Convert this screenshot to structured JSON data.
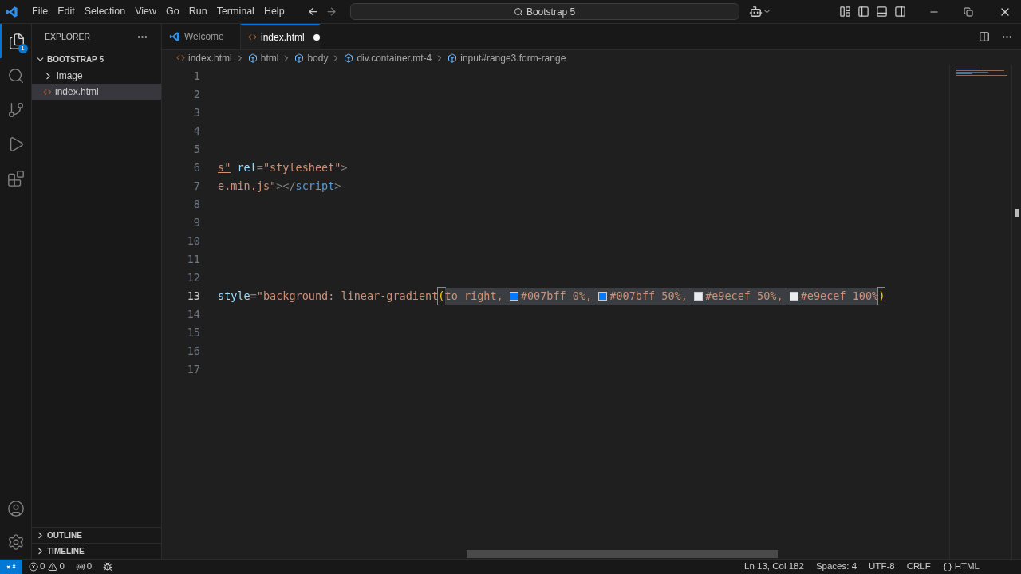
{
  "menu": [
    "File",
    "Edit",
    "Selection",
    "View",
    "Go",
    "Run",
    "Terminal",
    "Help"
  ],
  "command_center": {
    "value": "Bootstrap 5"
  },
  "activity_bar": {
    "explorer_badge": "1",
    "items": [
      {
        "kind": "files",
        "selected": true
      },
      {
        "kind": "search",
        "selected": false
      },
      {
        "kind": "source-control",
        "selected": false
      },
      {
        "kind": "run",
        "selected": false
      },
      {
        "kind": "extensions",
        "selected": false
      }
    ]
  },
  "sidebar": {
    "title": "EXPLORER",
    "folder": {
      "name": "BOOTSTRAP 5",
      "expanded": true,
      "children": [
        {
          "name": "image",
          "kind": "folder",
          "selected": false
        },
        {
          "name": "index.html",
          "kind": "html",
          "selected": true
        }
      ]
    },
    "panels": [
      {
        "name": "OUTLINE",
        "expanded": false
      },
      {
        "name": "TIMELINE",
        "expanded": false
      }
    ]
  },
  "tabs": [
    {
      "label": "Welcome",
      "kind": "welcome",
      "selected": false,
      "modified": false
    },
    {
      "label": "index.html",
      "kind": "html",
      "selected": true,
      "modified": true
    }
  ],
  "breadcrumbs": [
    {
      "label": "index.html",
      "kind": "file"
    },
    {
      "label": "html",
      "kind": "element"
    },
    {
      "label": "body",
      "kind": "element"
    },
    {
      "label": "div.container.mt-4",
      "kind": "element"
    },
    {
      "label": "input#range3.form-range",
      "kind": "element"
    }
  ],
  "editor": {
    "lines": [
      {
        "number": "1",
        "current": false
      },
      {
        "number": "2",
        "current": false
      },
      {
        "number": "3",
        "current": false
      },
      {
        "number": "4",
        "current": false
      },
      {
        "number": "5",
        "current": false
      },
      {
        "number": "6",
        "current": false,
        "tokens": [
          {
            "text": "s\"",
            "kind": "link"
          },
          {
            "text": " rel",
            "kind": "attr"
          },
          {
            "text": "=",
            "kind": "punct"
          },
          {
            "text": "\"stylesheet\"",
            "kind": "string"
          },
          {
            "text": ">",
            "kind": "punct"
          }
        ]
      },
      {
        "number": "7",
        "current": false,
        "tokens": [
          {
            "text": "e.min.js\"",
            "kind": "link"
          },
          {
            "text": "></",
            "kind": "punct"
          },
          {
            "text": "script",
            "kind": "tag"
          },
          {
            "text": ">",
            "kind": "punct"
          }
        ]
      },
      {
        "number": "8",
        "current": false
      },
      {
        "number": "9",
        "current": false
      },
      {
        "number": "10",
        "current": false
      },
      {
        "number": "11",
        "current": false
      },
      {
        "number": "12",
        "current": false
      },
      {
        "number": "13",
        "current": true,
        "tokens": [
          {
            "text": "style",
            "kind": "attr"
          },
          {
            "text": "=",
            "kind": "punct"
          },
          {
            "text": "\"background: linear-gradient",
            "kind": "string"
          },
          {
            "text": "(",
            "kind": "bracket"
          },
          {
            "text": "to right, ",
            "kind": "string",
            "highlighted": true
          },
          {
            "text": "#007bff 0%, ",
            "kind": "swatch",
            "color": "#007bff",
            "highlighted": true
          },
          {
            "text": "#007bff 50%, ",
            "kind": "swatch",
            "color": "#007bff",
            "highlighted": true
          },
          {
            "text": "#e9ecef 50%, ",
            "kind": "swatch",
            "color": "#e9ecef",
            "highlighted": true
          },
          {
            "text": "#e9ecef 100%",
            "kind": "swatch",
            "color": "#e9ecef",
            "highlighted": true
          },
          {
            "text": ")",
            "kind": "bracket"
          }
        ]
      },
      {
        "number": "14",
        "current": false
      },
      {
        "number": "15",
        "current": false
      },
      {
        "number": "16",
        "current": false
      },
      {
        "number": "17",
        "current": false
      }
    ]
  },
  "status_bar": {
    "errors": "0",
    "warnings": "0",
    "ports": "0",
    "position": "Ln 13, Col 182",
    "indent": "Spaces: 4",
    "encoding": "UTF-8",
    "eol": "CRLF",
    "language": "HTML"
  }
}
